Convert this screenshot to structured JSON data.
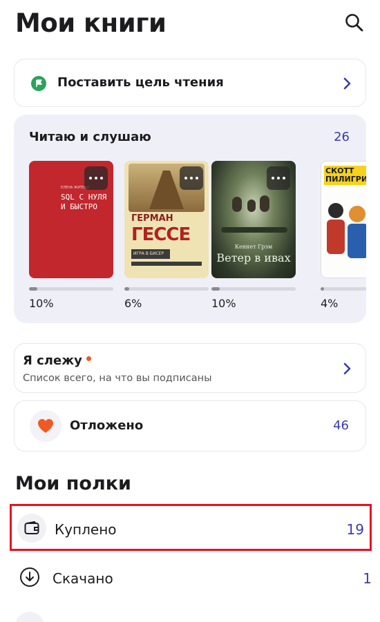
{
  "header": {
    "title": "Мои книги",
    "search_icon": "search-icon"
  },
  "goal": {
    "label": "Поставить цель чтения",
    "icon": "flag-icon",
    "icon_color": "#2aa35a"
  },
  "reading": {
    "title": "Читаю и слушаю",
    "count": "26",
    "books": [
      {
        "cover_text": "SQL С НУЛЯ И БЫСТРО",
        "author": "ЕЛЕНА ЖИТЕВА",
        "progress": "10%",
        "progress_value": 0.1
      },
      {
        "cover_text": "ГЕССЕ",
        "author": "ГЕРМАН",
        "subtitle": "ИГРА В БИСЕР",
        "progress": "6%",
        "progress_value": 0.06
      },
      {
        "cover_text": "Ветер в ивах",
        "author": "Кеннет Грэм",
        "progress": "10%",
        "progress_value": 0.1
      },
      {
        "cover_text": "СКОТТ ПИЛИГРИМ",
        "progress": "4%",
        "progress_value": 0.04
      }
    ]
  },
  "following": {
    "title": "Я слежу",
    "subtitle": "Список всего, на что вы подписаны",
    "dot_color": "#f05a22"
  },
  "saved": {
    "label": "Отложено",
    "count": "46",
    "icon": "heart-icon",
    "icon_color": "#f05a22"
  },
  "shelves": {
    "title": "Мои полки",
    "items": [
      {
        "label": "Куплено",
        "count": "19",
        "icon": "wallet-icon"
      },
      {
        "label": "Скачано",
        "count": "1",
        "icon": "download-icon"
      }
    ]
  },
  "colors": {
    "accent": "#3a3ab0",
    "highlight": "#e8101e"
  }
}
